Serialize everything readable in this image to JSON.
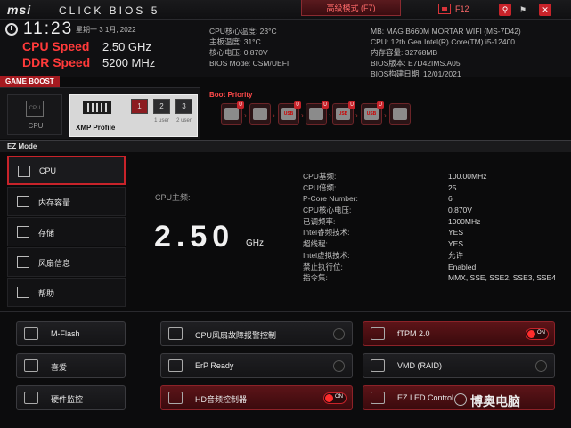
{
  "topbar": {
    "brand": "msi",
    "product": "CLICK BIOS 5",
    "mode_tab": "高级模式 (F7)",
    "f12_label": "F12",
    "search_glyph": "⚲",
    "lang_glyph": "⚑",
    "close_glyph": "✕"
  },
  "status": {
    "time": "11:23",
    "date": "星期一 3 1月, 2022",
    "cpu_speed_label": "CPU Speed",
    "cpu_speed_value": "2.50 GHz",
    "ddr_speed_label": "DDR Speed",
    "ddr_speed_value": "5200 MHz"
  },
  "sysinfo_left": [
    "CPU核心温度: 23°C",
    "主板温度: 31°C",
    "核心电压: 0.870V",
    "BIOS Mode: CSM/UEFI"
  ],
  "sysinfo_right": [
    "MB: MAG B660M MORTAR WIFI (MS-7D42)",
    "CPU: 12th Gen Intel(R) Core(TM) i5-12400",
    "内存容量: 32768MB",
    "BIOS版本: E7D42IMS.A05",
    "BIOS构建日期: 12/01/2021"
  ],
  "game_boost": {
    "label": "GAME BOOST",
    "cpu_chip_text": "CPU",
    "cpu_label": "CPU",
    "xmp_label": "XMP Profile",
    "slots": [
      {
        "num": "1",
        "sub": ""
      },
      {
        "num": "2",
        "sub": "1\nuser"
      },
      {
        "num": "3",
        "sub": "2\nuser"
      }
    ]
  },
  "boot": {
    "label": "Boot Priority",
    "devices": [
      {
        "glyph": "",
        "u": "U"
      },
      {
        "glyph": "",
        "u": ""
      },
      {
        "glyph": "USB",
        "u": "U"
      },
      {
        "glyph": "",
        "u": "U"
      },
      {
        "glyph": "USB",
        "u": "U"
      },
      {
        "glyph": "USB",
        "u": "U"
      },
      {
        "glyph": "",
        "u": ""
      }
    ]
  },
  "ez": {
    "label": "EZ Mode",
    "side_items": [
      "CPU",
      "内存容量",
      "存储",
      "风扇信息",
      "帮助"
    ],
    "cpu_main_label": "CPU主频:",
    "cpu_main_value": "2.50",
    "cpu_main_unit": "GHz",
    "specs": [
      {
        "k": "CPU基频:",
        "v": "100.00MHz"
      },
      {
        "k": "CPU倍频:",
        "v": "25"
      },
      {
        "k": "P-Core Number:",
        "v": "6"
      },
      {
        "k": "CPU核心电压:",
        "v": "0.870V"
      },
      {
        "k": "已调频率:",
        "v": "1000MHz"
      },
      {
        "k": "Intel睿频技术:",
        "v": "YES"
      },
      {
        "k": "超线程:",
        "v": "YES"
      },
      {
        "k": "Intel虚拟技术:",
        "v": "允许"
      },
      {
        "k": "禁止执行位:",
        "v": "Enabled"
      },
      {
        "k": "指令集:",
        "v": "MMX, SSE, SSE2, SSE3, SSE4"
      }
    ]
  },
  "bottom": {
    "left": [
      "M-Flash",
      "喜爱",
      "硬件监控"
    ],
    "mid": [
      "CPU风扇故障报警控制",
      "ErP Ready",
      "HD音频控制器"
    ],
    "right": [
      "fTPM 2.0",
      "VMD (RAID)",
      "EZ LED Control"
    ],
    "on_text": "ON"
  },
  "watermark": "博奥电脑"
}
